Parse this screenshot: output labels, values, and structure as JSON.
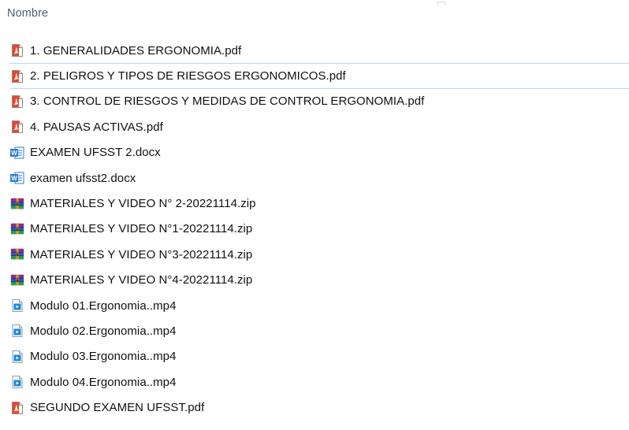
{
  "header": {
    "column_name": "Nombre"
  },
  "files": [
    {
      "name": "1. GENERALIDADES ERGONOMIA.pdf",
      "icon": "pdf-icon",
      "type": "pdf"
    },
    {
      "name": "2. PELIGROS Y TIPOS DE RIESGOS ERGONOMICOS.pdf",
      "icon": "pdf-icon",
      "type": "pdf",
      "state": "hover"
    },
    {
      "name": "3. CONTROL DE RIESGOS Y MEDIDAS DE CONTROL ERGONOMIA.pdf",
      "icon": "pdf-icon",
      "type": "pdf"
    },
    {
      "name": "4. PAUSAS ACTIVAS.pdf",
      "icon": "pdf-icon",
      "type": "pdf"
    },
    {
      "name": "EXAMEN UFSST 2.docx",
      "icon": "word-document-icon",
      "type": "docx"
    },
    {
      "name": "examen ufsst2.docx",
      "icon": "word-document-icon",
      "type": "docx"
    },
    {
      "name": "MATERIALES Y VIDEO N° 2-20221114.zip",
      "icon": "winrar-archive-icon",
      "type": "zip"
    },
    {
      "name": "MATERIALES Y VIDEO N°1-20221114.zip",
      "icon": "winrar-archive-icon",
      "type": "zip"
    },
    {
      "name": "MATERIALES Y VIDEO N°3-20221114.zip",
      "icon": "winrar-archive-icon",
      "type": "zip"
    },
    {
      "name": "MATERIALES Y VIDEO N°4-20221114.zip",
      "icon": "winrar-archive-icon",
      "type": "zip"
    },
    {
      "name": "Modulo 01.Ergonomia..mp4",
      "icon": "video-file-icon",
      "type": "mp4"
    },
    {
      "name": "Modulo 02.Ergonomia..mp4",
      "icon": "video-file-icon",
      "type": "mp4"
    },
    {
      "name": "Modulo 03.Ergonomia..mp4",
      "icon": "video-file-icon",
      "type": "mp4"
    },
    {
      "name": "Modulo 04.Ergonomia..mp4",
      "icon": "video-file-icon",
      "type": "mp4"
    },
    {
      "name": "SEGUNDO EXAMEN UFSST.pdf",
      "icon": "pdf-icon",
      "type": "pdf"
    }
  ],
  "colors": {
    "header_text": "#4c6072",
    "hover_border": "#bcd9f1",
    "pdf_red": "#e9462c",
    "word_blue": "#2b7cd3",
    "video_blue": "#1e88d6"
  }
}
